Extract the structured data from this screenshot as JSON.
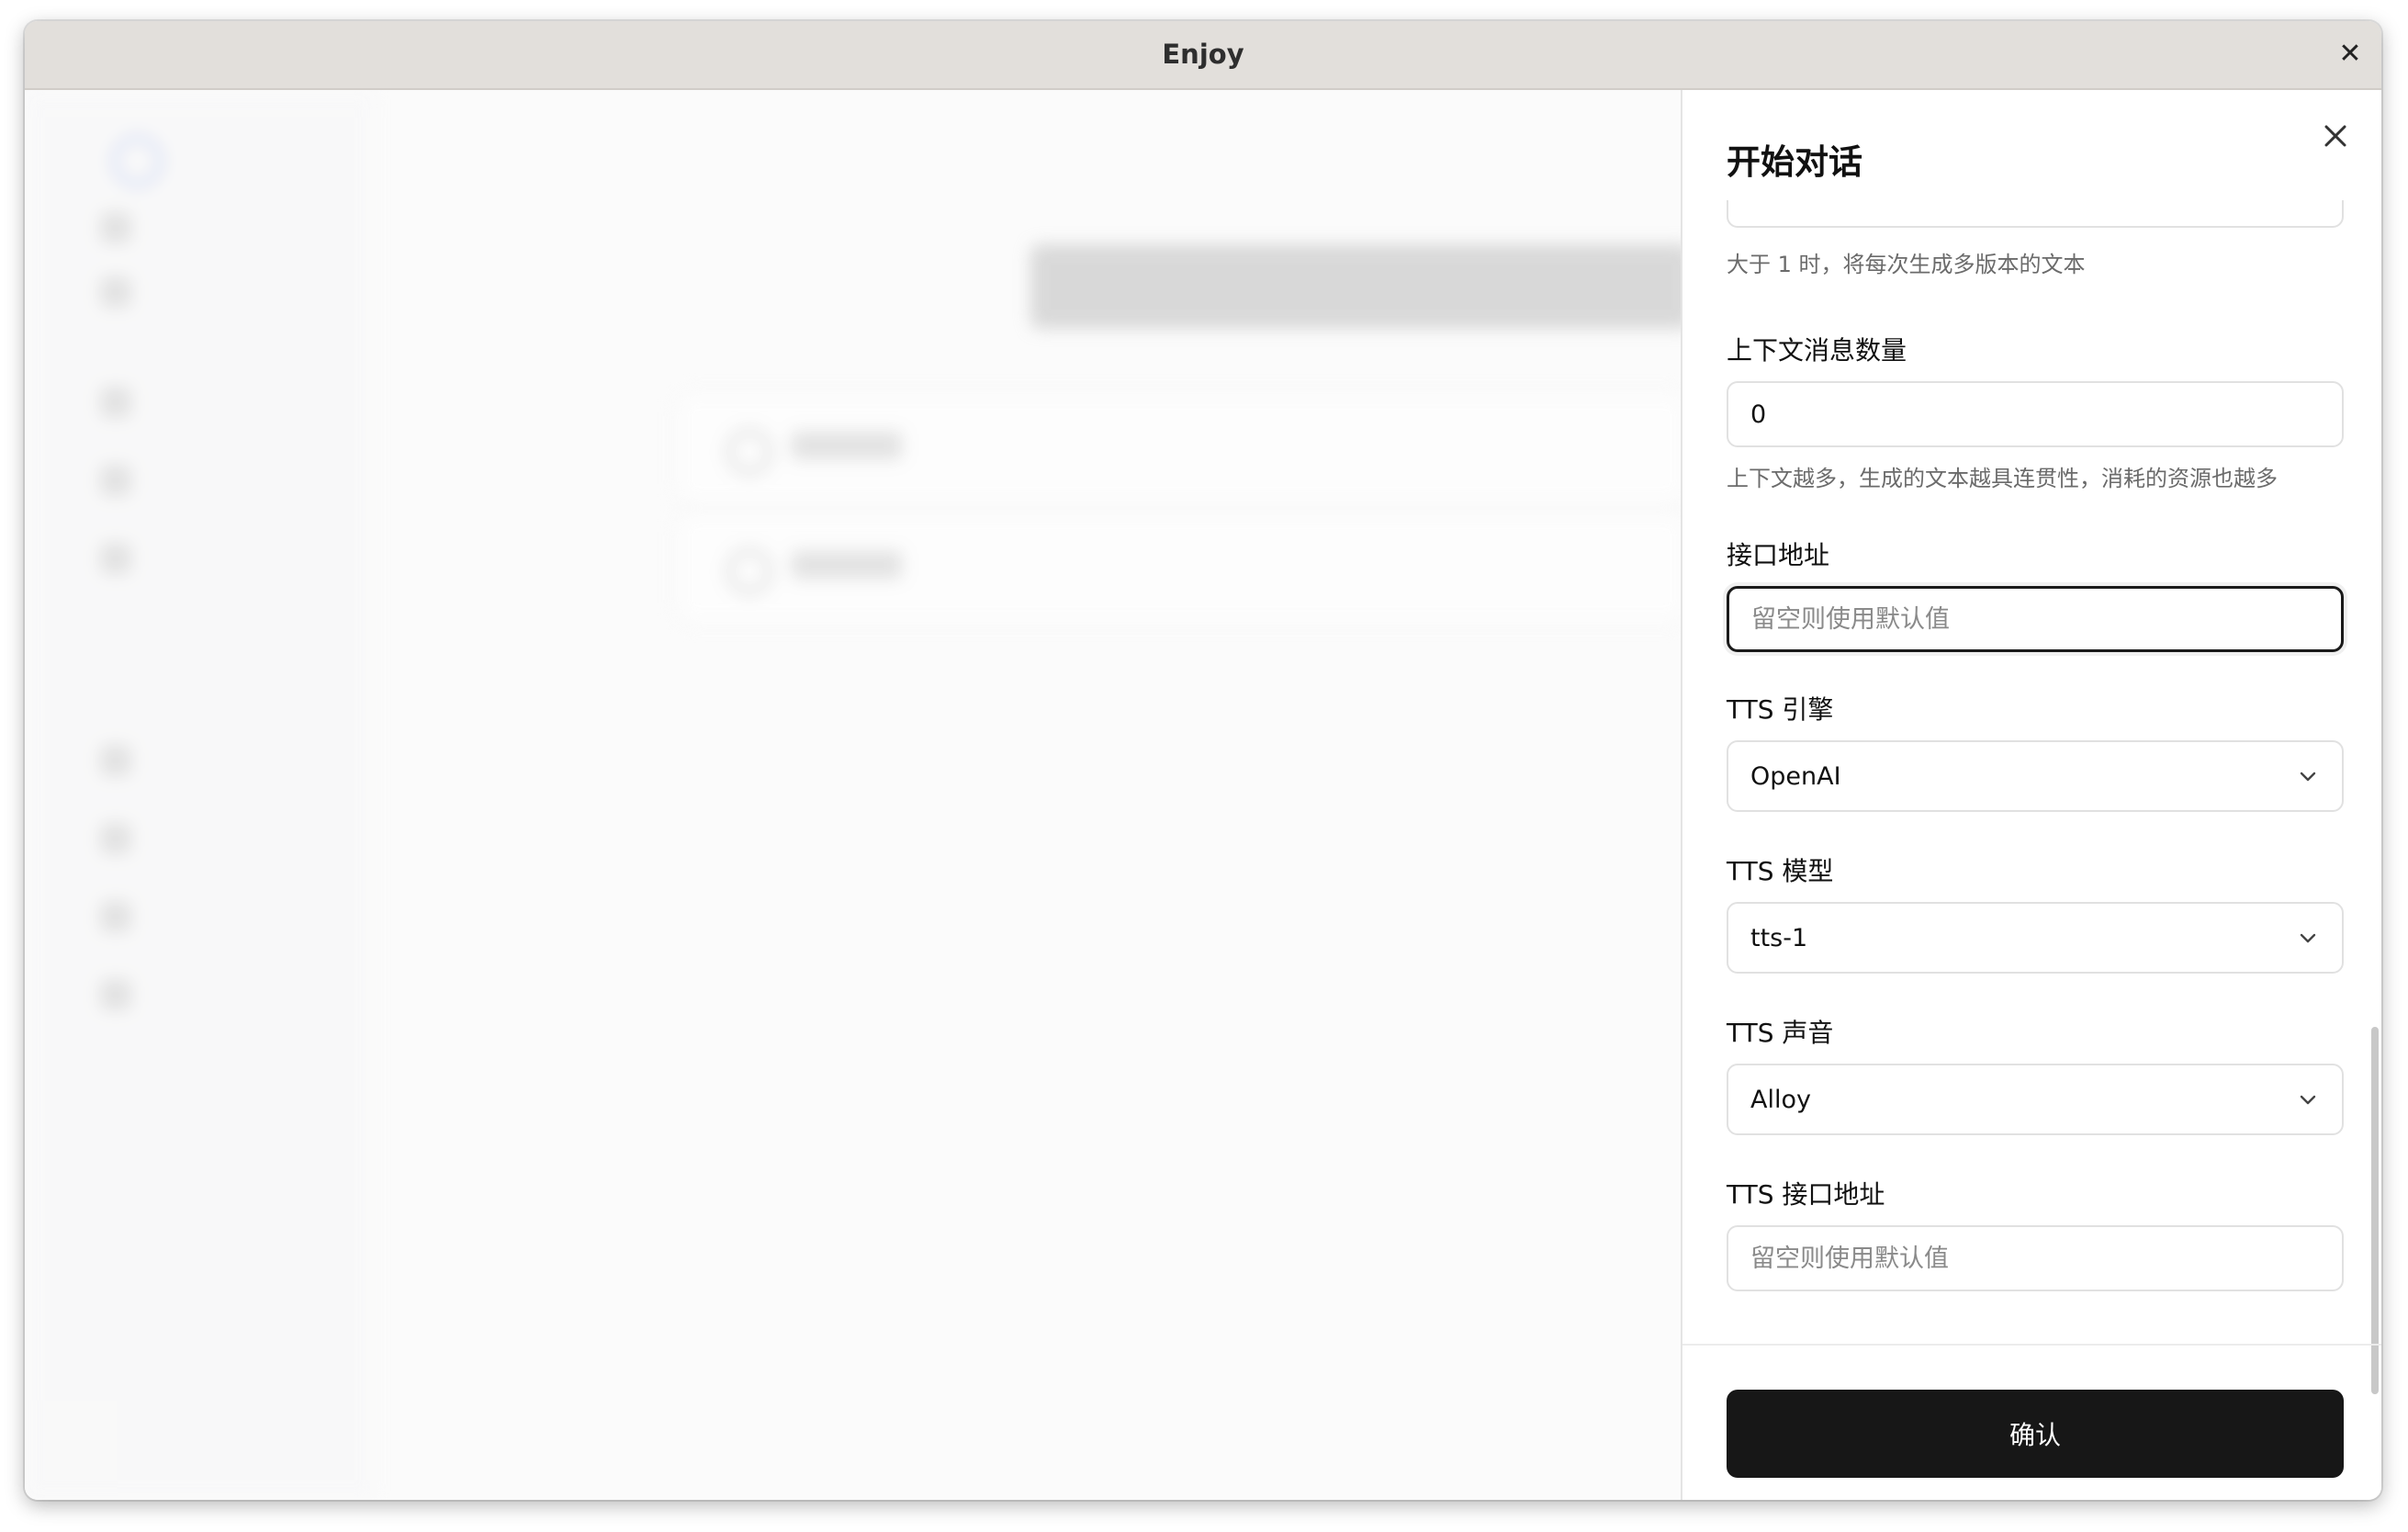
{
  "window": {
    "title": "Enjoy"
  },
  "dialog": {
    "title": "开始对话",
    "n_help": "大于 1 时，将每次生成多版本的文本",
    "context": {
      "label": "上下文消息数量",
      "value": "0",
      "help": "上下文越多，生成的文本越具连贯性，消耗的资源也越多"
    },
    "base_url": {
      "label": "接口地址",
      "placeholder": "留空则使用默认值"
    },
    "tts_engine": {
      "label": "TTS 引擎",
      "value": "OpenAI"
    },
    "tts_model": {
      "label": "TTS 模型",
      "value": "tts-1"
    },
    "tts_voice": {
      "label": "TTS 声音",
      "value": "Alloy"
    },
    "tts_base_url": {
      "label": "TTS 接口地址",
      "placeholder": "留空则使用默认值"
    },
    "confirm_label": "确认"
  },
  "icons": {
    "window_close": "close-icon",
    "dialog_close": "close-icon",
    "select_arrow": "chevron-down-icon"
  }
}
